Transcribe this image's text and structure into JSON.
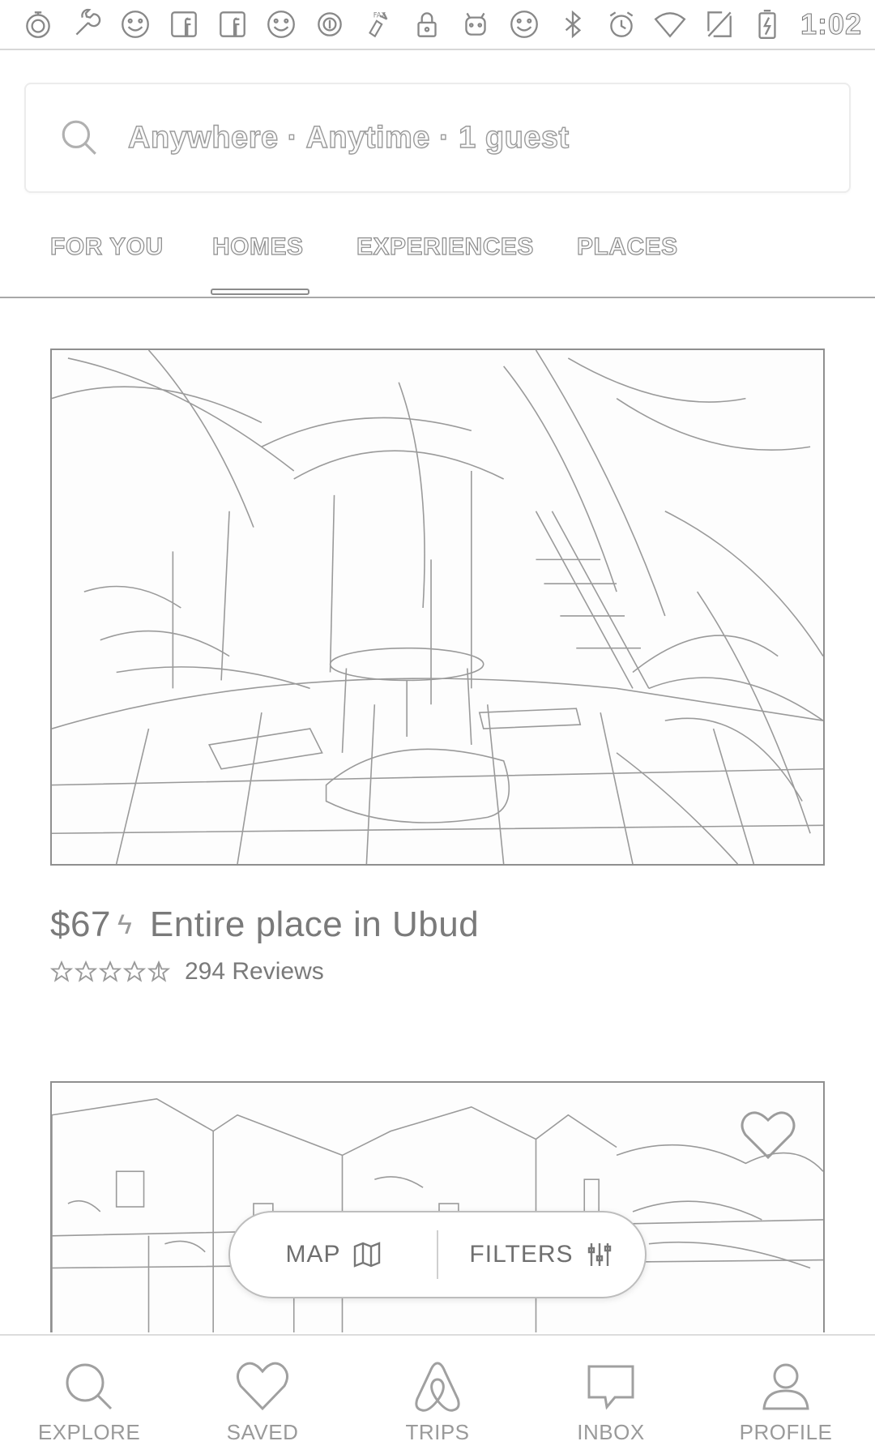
{
  "status_bar": {
    "icons": [
      "stopwatch-icon",
      "wrench-icon",
      "smiley-icon",
      "facebook-icon",
      "facebook-icon",
      "smiley-icon",
      "circle-icon",
      "fax-icon",
      "lock-icon",
      "android-icon",
      "smiley-icon",
      "bluetooth-icon",
      "alarm-icon",
      "wifi-icon",
      "no-sim-icon",
      "battery-charging-icon"
    ],
    "time": "1:02"
  },
  "search": {
    "placeholder": "Anywhere · Anytime · 1 guest"
  },
  "tabs": [
    {
      "label": "FOR YOU",
      "active": false
    },
    {
      "label": "HOMES",
      "active": true
    },
    {
      "label": "EXPERIENCES",
      "active": false
    },
    {
      "label": "PLACES",
      "active": false
    }
  ],
  "listings": [
    {
      "price": "$67",
      "title": "Entire place in Ubud",
      "rating": 4.5,
      "reviews": "294 Reviews"
    }
  ],
  "floating": {
    "map_label": "MAP",
    "filters_label": "FILTERS"
  },
  "bottom_nav": [
    {
      "label": "EXPLORE",
      "icon": "search-icon"
    },
    {
      "label": "SAVED",
      "icon": "heart-icon"
    },
    {
      "label": "TRIPS",
      "icon": "airbnb-logo-icon"
    },
    {
      "label": "INBOX",
      "icon": "chat-bubble-icon"
    },
    {
      "label": "PROFILE",
      "icon": "person-icon"
    }
  ],
  "colors": {
    "line": "#8c8c8c",
    "text": "#7a7a7a",
    "background": "#ffffff"
  }
}
